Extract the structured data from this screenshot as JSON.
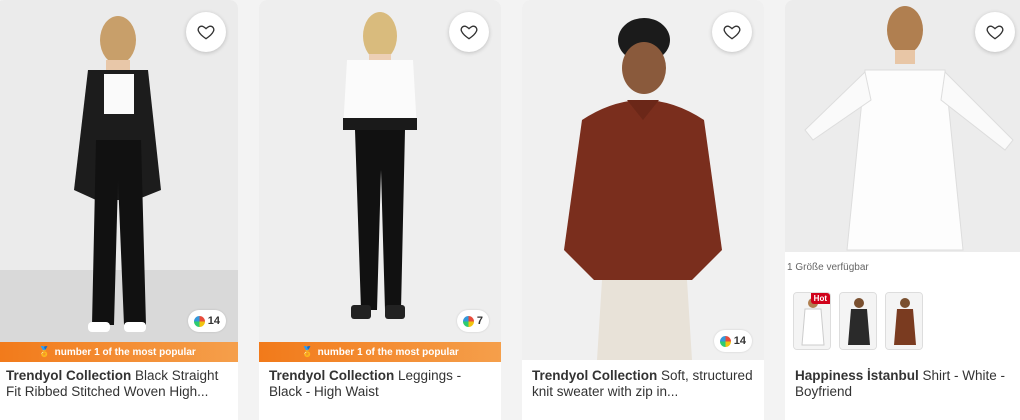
{
  "products": [
    {
      "brand": "Trendyol Collection",
      "title": "Black Straight Fit Ribbed Stitched Woven High...",
      "colors": "14",
      "badge": "number 1 of the most popular"
    },
    {
      "brand": "Trendyol Collection",
      "title": "Leggings - Black - High Waist",
      "colors": "7",
      "badge": "number 1 of the most popular"
    },
    {
      "brand": "Trendyol Collection",
      "title": "Soft, structured knit sweater with zip in...",
      "colors": "14"
    },
    {
      "brand": "Happiness İstanbul",
      "title": "Shirt - White - Boyfriend",
      "availability": "1 Größe verfügbar",
      "hot": "Hot"
    }
  ],
  "colors": {
    "accent": "#f27a1a",
    "hot": "#d0021b"
  }
}
